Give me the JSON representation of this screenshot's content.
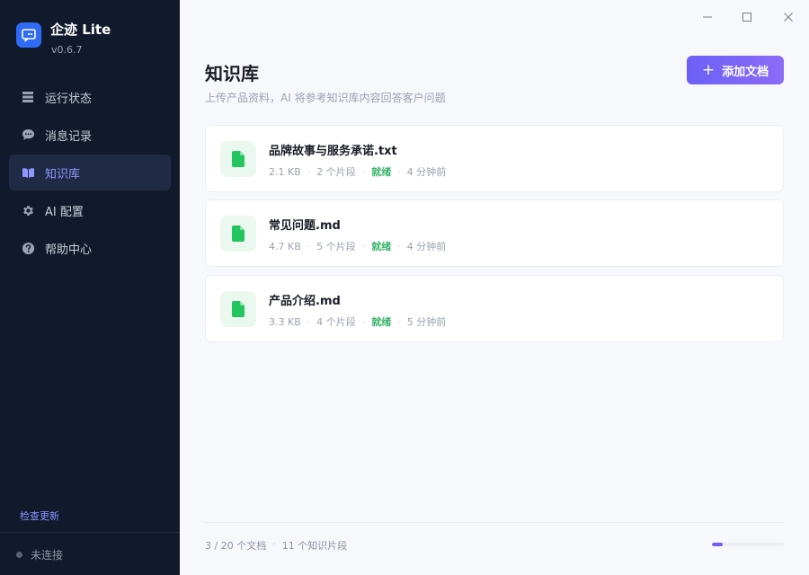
{
  "app": {
    "name": "企迹 Lite",
    "version": "v0.6.7"
  },
  "colors": {
    "accent": "#6e60f7",
    "sidebar_bg": "#111a2c",
    "ready": "#3bb36b",
    "logo": "#2f6bf5"
  },
  "sidebar": {
    "items": [
      {
        "label": "运行状态",
        "icon": "server-icon"
      },
      {
        "label": "消息记录",
        "icon": "chat-bubble-icon"
      },
      {
        "label": "知识库",
        "icon": "book-icon",
        "active": true
      },
      {
        "label": "AI 配置",
        "icon": "gear-icon"
      },
      {
        "label": "帮助中心",
        "icon": "help-circle-icon"
      }
    ],
    "update_link": "检查更新",
    "connection_status": "未连接"
  },
  "header": {
    "title": "知识库",
    "subtitle": "上传产品资料，AI 将参考知识库内容回答客户问题",
    "add_button": "添加文档"
  },
  "files": [
    {
      "name": "品牌故事与服务承诺.txt",
      "size": "2.1 KB",
      "chunks": "2 个片段",
      "status": "就绪",
      "time": "4 分钟前",
      "icon": "file-icon"
    },
    {
      "name": "常见问题.md",
      "size": "4.7 KB",
      "chunks": "5 个片段",
      "status": "就绪",
      "time": "4 分钟前",
      "icon": "file-icon"
    },
    {
      "name": "产品介绍.md",
      "size": "3.3 KB",
      "chunks": "4 个片段",
      "status": "就绪",
      "time": "5 分钟前",
      "icon": "file-icon"
    }
  ],
  "footer": {
    "doc_count": "3 / 20 个文档",
    "chunk_count": "11 个知识片段",
    "usage_fraction": 0.15
  },
  "window_controls": [
    "minimize-icon",
    "maximize-icon",
    "close-icon"
  ]
}
